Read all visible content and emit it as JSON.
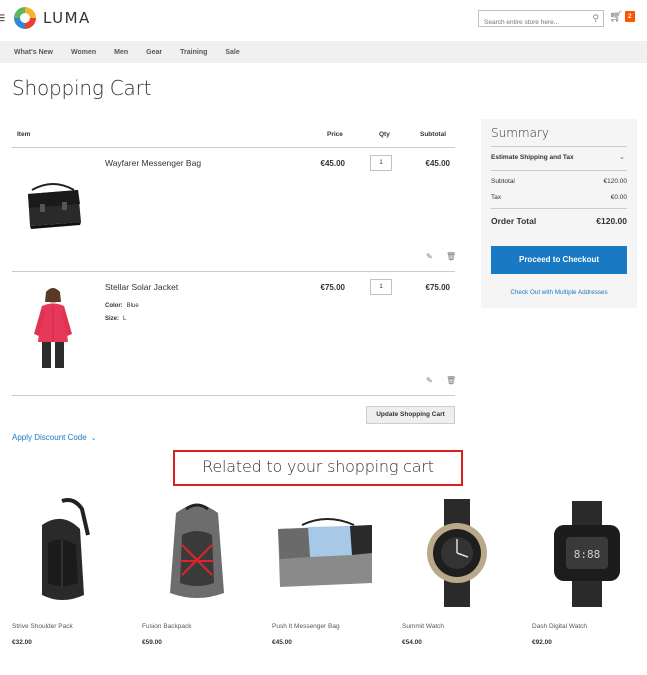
{
  "header": {
    "menu_icon": "hamburger-icon",
    "logo_text": "LUMA",
    "search_placeholder": "Search entire store here...",
    "cart_count": "2"
  },
  "nav": [
    "What's New",
    "Women",
    "Men",
    "Gear",
    "Training",
    "Sale"
  ],
  "page_title": "Shopping Cart",
  "cart": {
    "headers": {
      "item": "Item",
      "price": "Price",
      "qty": "Qty",
      "subtotal": "Subtotal"
    },
    "items": [
      {
        "name": "Wayfarer Messenger Bag",
        "price": "€45.00",
        "qty": "1",
        "subtotal": "€45.00",
        "options": []
      },
      {
        "name": "Stellar Solar Jacket",
        "price": "€75.00",
        "qty": "1",
        "subtotal": "€75.00",
        "options": [
          {
            "label": "Color:",
            "value": "Blue"
          },
          {
            "label": "Size:",
            "value": "L"
          }
        ]
      }
    ],
    "update_label": "Update Shopping Cart",
    "discount_label": "Apply Discount Code"
  },
  "summary": {
    "title": "Summary",
    "estimate_label": "Estimate Shipping and Tax",
    "subtotal_label": "Subtotal",
    "subtotal_value": "€120.00",
    "tax_label": "Tax",
    "tax_value": "€0.00",
    "order_total_label": "Order Total",
    "order_total_value": "€120.00",
    "checkout_label": "Proceed to Checkout",
    "multi_label": "Check Out with Multiple Addresses"
  },
  "related": {
    "title": "Related to your shopping cart",
    "items": [
      {
        "name": "Strive Shoulder Pack",
        "price": "€32.00"
      },
      {
        "name": "Fusion Backpack",
        "price": "€59.00"
      },
      {
        "name": "Push It Messenger Bag",
        "price": "€45.00"
      },
      {
        "name": "Summit Watch",
        "price": "€54.00"
      },
      {
        "name": "Dash Digital Watch",
        "price": "€92.00"
      }
    ]
  },
  "colors": {
    "accent": "#1979c3",
    "badge": "#ff5501",
    "highlight": "#d9201f"
  }
}
